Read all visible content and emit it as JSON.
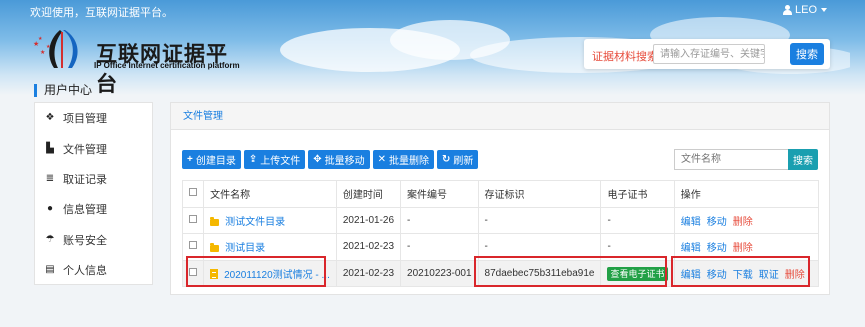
{
  "topbar": {
    "welcome": "欢迎使用，互联网证据平台。",
    "user": "LEO"
  },
  "logo": {
    "title": "互联网证据平台",
    "subtitle": "IP Office Internet certification platform"
  },
  "search": {
    "label": "证据材料搜索:",
    "placeholder": "请输入存证编号、关键字...",
    "button": "搜索"
  },
  "sidebar": {
    "title": "用户中心",
    "items": [
      {
        "label": "项目管理",
        "icon": "cubes-icon"
      },
      {
        "label": "文件管理",
        "icon": "file-icon"
      },
      {
        "label": "取证记录",
        "icon": "database-icon"
      },
      {
        "label": "信息管理",
        "icon": "comment-icon"
      },
      {
        "label": "账号安全",
        "icon": "umbrella-icon"
      },
      {
        "label": "个人信息",
        "icon": "id-card-icon"
      }
    ]
  },
  "panel": {
    "title": "文件管理"
  },
  "toolbar": {
    "buttons": [
      {
        "label": "创建目录",
        "icon": "plus-icon"
      },
      {
        "label": "上传文件",
        "icon": "upload-icon"
      },
      {
        "label": "批量移动",
        "icon": "move-icon"
      },
      {
        "label": "批量删除",
        "icon": "times-icon"
      },
      {
        "label": "刷新",
        "icon": "refresh-icon"
      }
    ],
    "file_search_placeholder": "文件名称",
    "file_search_button": "搜索"
  },
  "table": {
    "headers": [
      "文件名称",
      "创建时间",
      "案件编号",
      "存证标识",
      "电子证书",
      "操作"
    ],
    "rows": [
      {
        "name": "测试文件目录",
        "type": "folder",
        "created": "2021-01-26",
        "case_no": "-",
        "evidence_id": "-",
        "certificate": "-",
        "ops": [
          "编辑",
          "移动",
          "删除"
        ]
      },
      {
        "name": "测试目录",
        "type": "folder",
        "created": "2021-02-23",
        "case_no": "-",
        "evidence_id": "-",
        "certificate": "-",
        "ops": [
          "编辑",
          "移动",
          "删除"
        ]
      },
      {
        "name": "202011120测试情况 - ...",
        "type": "file",
        "created": "2021-02-23",
        "case_no": "20210223-001",
        "evidence_id": "87daebec75b311eba91e",
        "certificate": "查看电子证书",
        "ops": [
          "编辑",
          "移动",
          "下载",
          "取证",
          "删除"
        ]
      }
    ]
  },
  "colors": {
    "accent": "#1a7fe0",
    "danger": "#e74c3c",
    "success": "#22a046",
    "highlight": "#d9262b",
    "header_sky": "#4a9ad8"
  }
}
